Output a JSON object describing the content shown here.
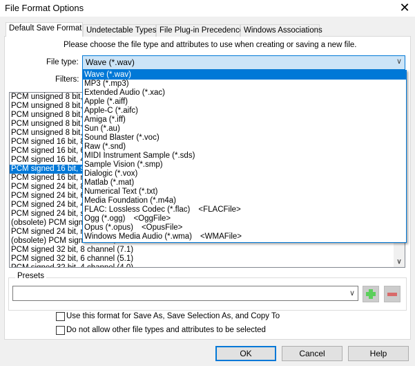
{
  "window": {
    "title": "File Format Options",
    "close_icon": "close-icon"
  },
  "tabs": [
    {
      "label": "Default Save Format",
      "active": true
    },
    {
      "label": "Undetectable Types"
    },
    {
      "label": "File Plug-in Precedence"
    },
    {
      "label": "Windows Associations"
    }
  ],
  "prompt": "Please choose the file type and attributes to use when creating or saving a new file.",
  "file_type": {
    "label": "File type:",
    "value": "Wave (*.wav)"
  },
  "filters": {
    "label": "Filters:"
  },
  "dropdown_options": [
    {
      "label": "Wave (*.wav)",
      "selected": true
    },
    {
      "label": "MP3 (*.mp3)"
    },
    {
      "label": "Extended Audio (*.xac)"
    },
    {
      "label": "Apple (*.aiff)"
    },
    {
      "label": "Apple-C (*.aifc)"
    },
    {
      "label": "Amiga (*.iff)"
    },
    {
      "label": "Sun (*.au)"
    },
    {
      "label": "Sound Blaster (*.voc)"
    },
    {
      "label": "Raw (*.snd)"
    },
    {
      "label": "MIDI Instrument Sample (*.sds)"
    },
    {
      "label": "Sample Vision (*.smp)"
    },
    {
      "label": "Dialogic (*.vox)"
    },
    {
      "label": "Matlab (*.mat)"
    },
    {
      "label": "Numerical Text (*.txt)"
    },
    {
      "label": "Media Foundation (*.m4a)"
    },
    {
      "label": "FLAC: Lossless Codec (*.flac)",
      "tag": "<FLACFile>"
    },
    {
      "label": "Ogg (*.ogg)",
      "tag": "<OggFile>"
    },
    {
      "label": "Opus (*.opus)",
      "tag": "<OpusFile>"
    },
    {
      "label": "Windows Media Audio (*.wma)",
      "tag": "<WMAFile>"
    }
  ],
  "formats": [
    "PCM unsigned 8 bit, 8 channel (7.1)",
    "PCM unsigned 8 bit, 6 channel (5.1)",
    "PCM unsigned 8 bit, 4 channel (4.0)",
    "PCM unsigned 8 bit, stereo",
    "PCM unsigned 8 bit, mono",
    "PCM signed 16 bit, 8 channel (7.1)",
    "PCM signed 16 bit, 6 channel (5.1)",
    "PCM signed 16 bit, 4 channel (4.0)",
    "PCM signed 16 bit, stereo",
    "PCM signed 16 bit, mono",
    "PCM signed 24 bit, 8 channel (7.1)",
    "PCM signed 24 bit, 6 channel (5.1)",
    "PCM signed 24 bit, 4 channel (4.0)",
    "PCM signed 24 bit, stereo",
    "(obsolete) PCM signed 24 bit, stereo",
    "PCM signed 24 bit, mono",
    "(obsolete) PCM signed 24 bit, mono",
    "PCM signed 32 bit, 8 channel (7.1)",
    "PCM signed 32 bit, 6 channel (5.1)",
    "PCM signed 32 bit, 4 channel (4.0)"
  ],
  "selected_format_index": 8,
  "presets": {
    "label": "Presets",
    "value": "",
    "add_icon": "plus-icon",
    "remove_icon": "minus-icon",
    "add_color": "#5ccf5c",
    "remove_color": "#d86a6a"
  },
  "checkboxes": [
    {
      "label": "Use this format for Save As, Save Selection As, and Copy To",
      "checked": false
    },
    {
      "label": "Do not allow other file types and attributes to be selected",
      "checked": false
    }
  ],
  "buttons": {
    "ok": "OK",
    "cancel": "Cancel",
    "help": "Help"
  },
  "colors": {
    "accent": "#0078d7",
    "combo_bg": "#cce4f7"
  }
}
